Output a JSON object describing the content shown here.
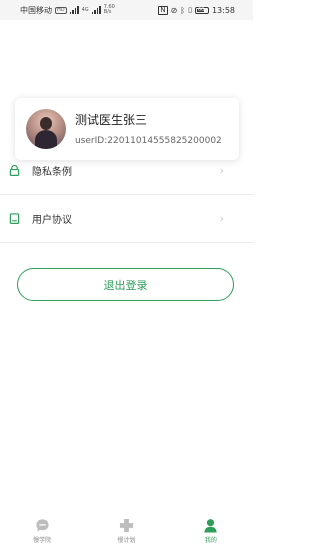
{
  "status_bar": {
    "carrier": "中国移动",
    "hd": "HD",
    "network": "4G",
    "speed_top": "7.60",
    "speed_bottom": "B/s",
    "battery": "60",
    "time": "13:58"
  },
  "profile": {
    "name": "测试医生张三",
    "user_id": "userID:22011014555825200002"
  },
  "menu": [
    {
      "label": "隐私条例",
      "icon": "privacy-icon"
    },
    {
      "label": "用户协议",
      "icon": "agreement-icon"
    }
  ],
  "logout_label": "退出登录",
  "bottom_nav": [
    {
      "label": "慢学院",
      "icon": "chat-bubble-icon",
      "active": false
    },
    {
      "label": "慢计划",
      "icon": "cross-icon",
      "active": false
    },
    {
      "label": "我的",
      "icon": "person-icon",
      "active": true
    }
  ],
  "colors": {
    "accent": "#2f9e5a",
    "inactive": "#bdbdbd",
    "divider": "#ececec"
  }
}
